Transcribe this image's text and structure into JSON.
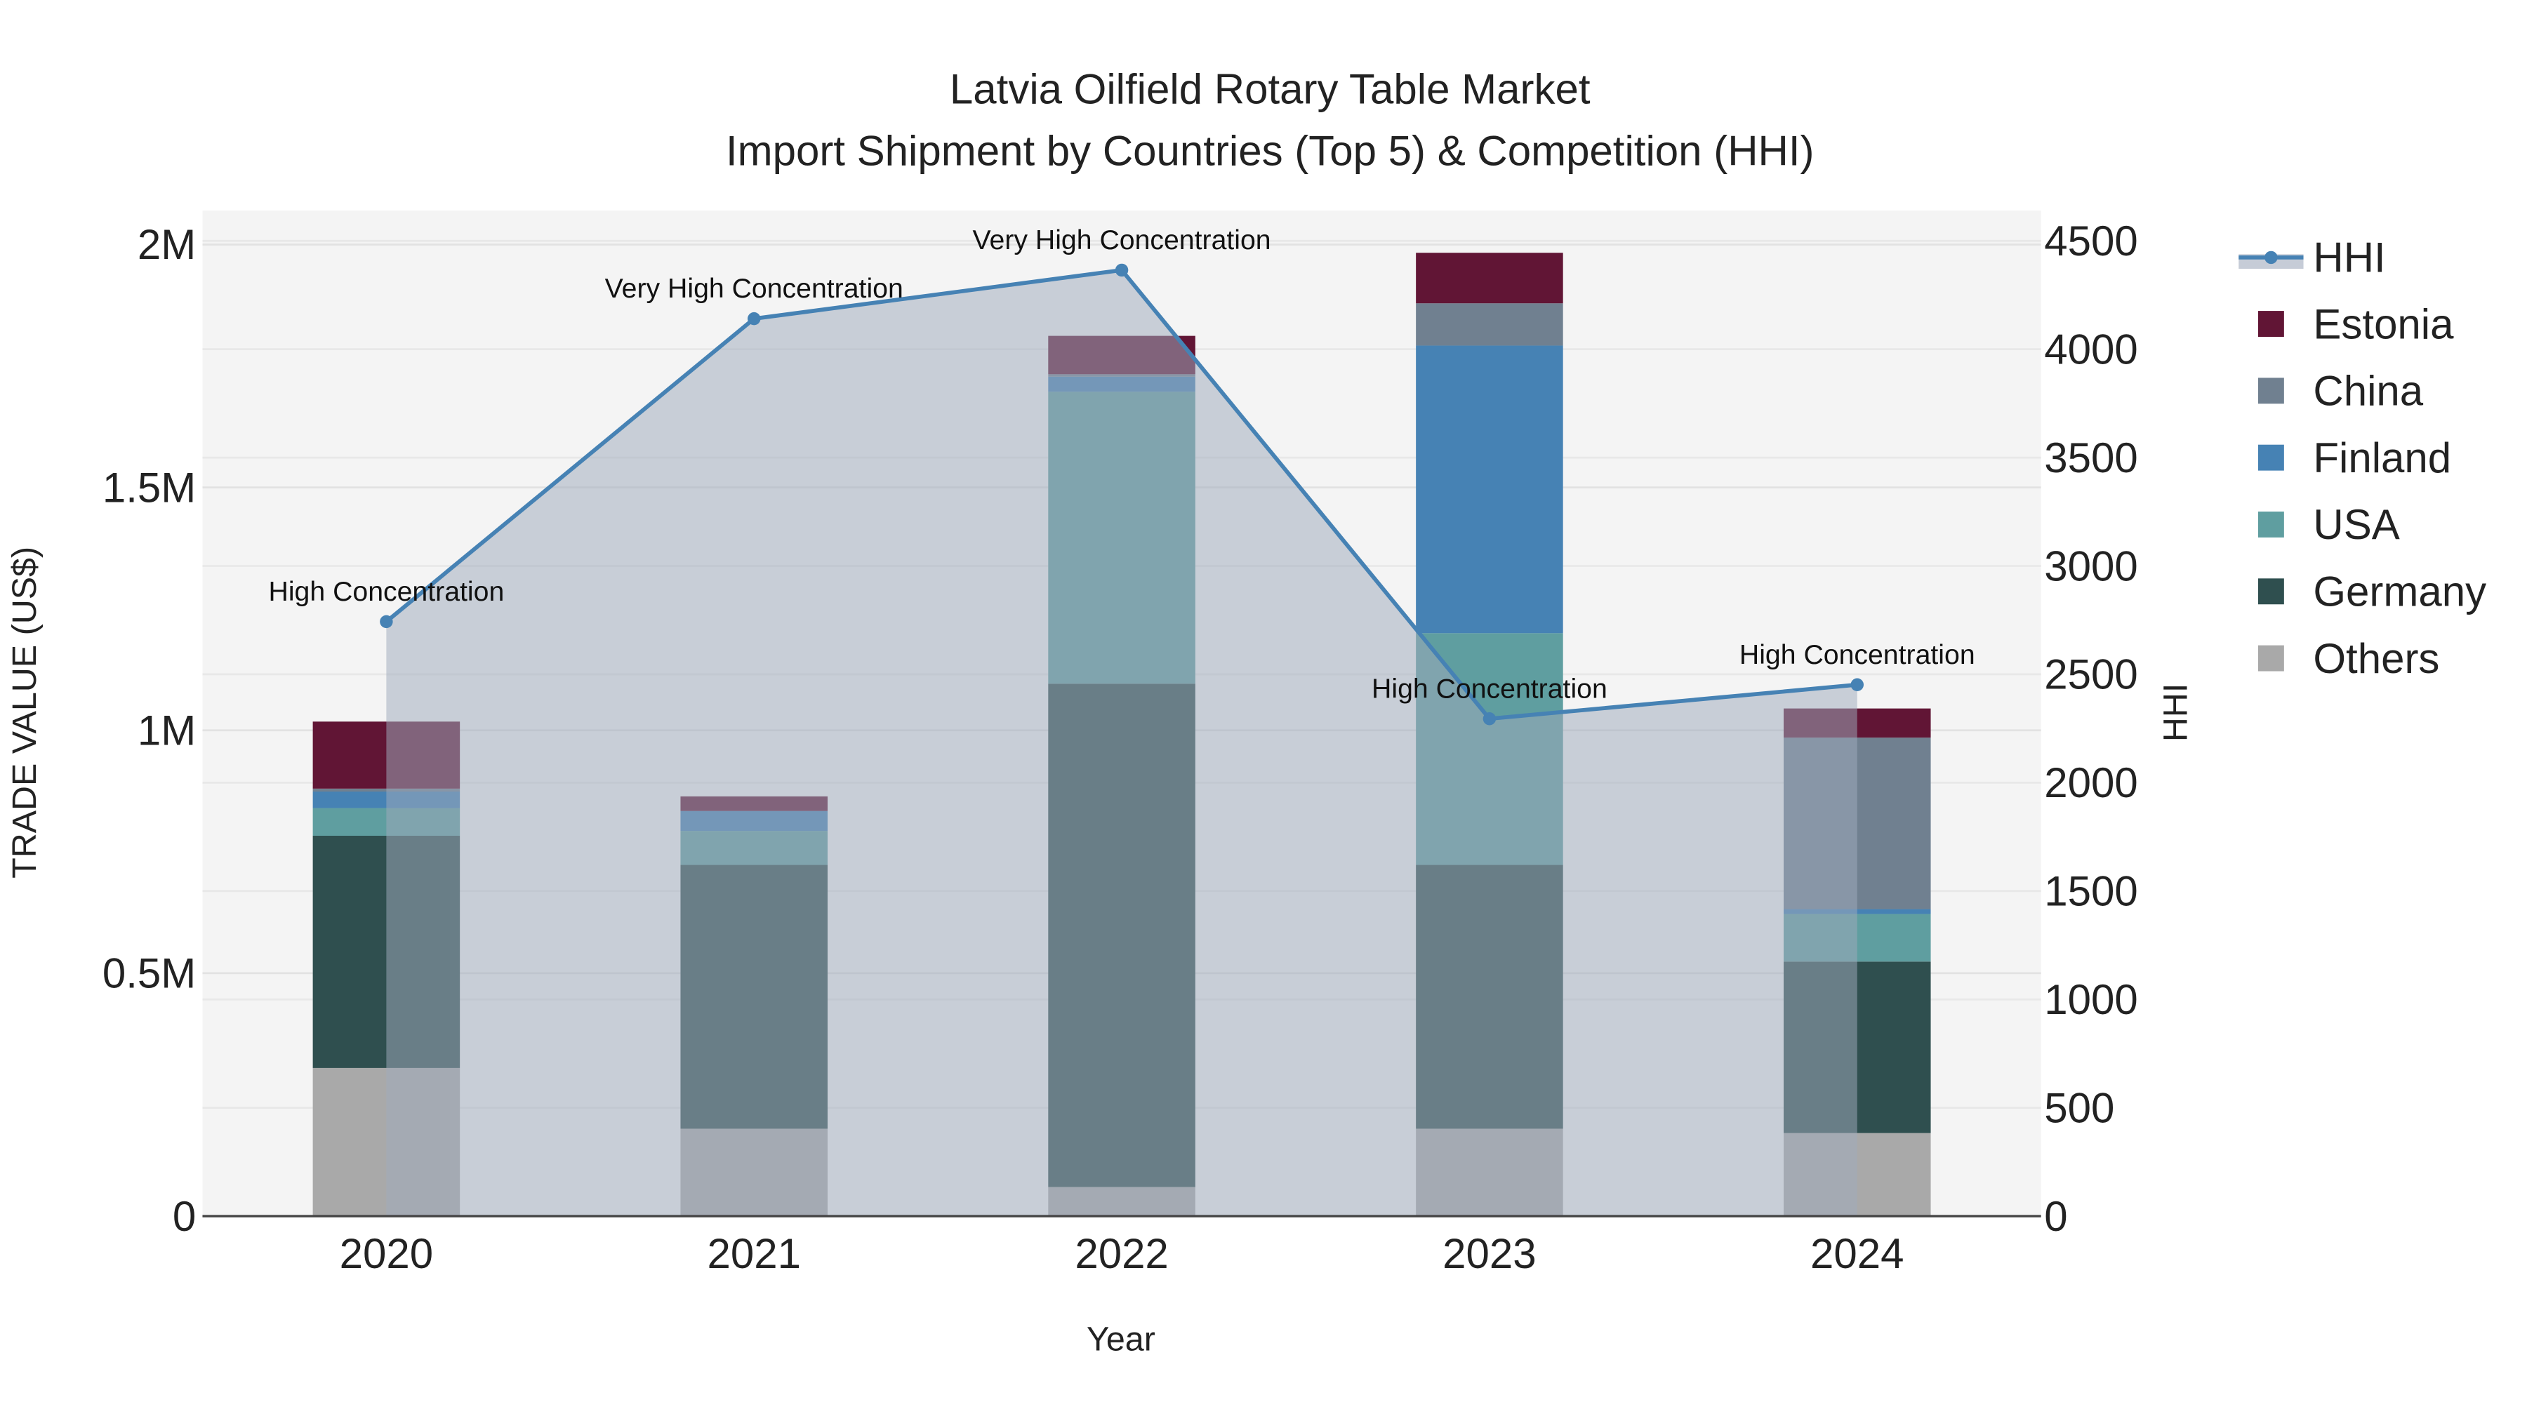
{
  "chart_data": {
    "type": "bar",
    "stacked": true,
    "title": "Latvia Oilfield Rotary Table Market",
    "subtitle": "Import Shipment by Countries (Top 5) & Competition (HHI)",
    "xlabel": "Year",
    "ylabel": "TRADE VALUE (US$)",
    "y2label": "HHI",
    "categories": [
      "2020",
      "2021",
      "2022",
      "2023",
      "2024"
    ],
    "ylim": [
      0,
      2070000
    ],
    "y2lim": [
      0,
      4640
    ],
    "yticks": [
      {
        "v": 0,
        "label": "0"
      },
      {
        "v": 500000,
        "label": "0.5M"
      },
      {
        "v": 1000000,
        "label": "1M"
      },
      {
        "v": 1500000,
        "label": "1.5M"
      },
      {
        "v": 2000000,
        "label": "2M"
      }
    ],
    "y2ticks": [
      0,
      500,
      1000,
      1500,
      2000,
      2500,
      3000,
      3500,
      4000,
      4500
    ],
    "series": [
      {
        "name": "Others",
        "color": "#a9a9a9",
        "values": [
          305000,
          180000,
          60000,
          180000,
          171000
        ]
      },
      {
        "name": "Germany",
        "color": "#2f4f4f",
        "values": [
          478000,
          543000,
          1036000,
          543000,
          353000
        ]
      },
      {
        "name": "USA",
        "color": "#5f9ea0",
        "values": [
          57000,
          70000,
          601000,
          477000,
          98000
        ]
      },
      {
        "name": "Finland",
        "color": "#4682b4",
        "values": [
          34000,
          41000,
          31000,
          592000,
          10000
        ]
      },
      {
        "name": "China",
        "color": "#708090",
        "values": [
          6000,
          0,
          5000,
          87000,
          353000
        ]
      },
      {
        "name": "Estonia",
        "color": "#611535",
        "values": [
          138000,
          30000,
          79000,
          104000,
          60000
        ]
      }
    ],
    "hhi": {
      "name": "HHI",
      "color": "#4682b4",
      "values": [
        2743,
        4141,
        4365,
        2295,
        2452
      ],
      "labels": [
        "High Concentration",
        "Very High Concentration",
        "Very High Concentration",
        "High Concentration",
        "High Concentration"
      ]
    },
    "legend": {
      "placement": "right",
      "items": [
        "HHI",
        "Estonia",
        "China",
        "Finland",
        "USA",
        "Germany",
        "Others"
      ]
    },
    "grid": true
  }
}
